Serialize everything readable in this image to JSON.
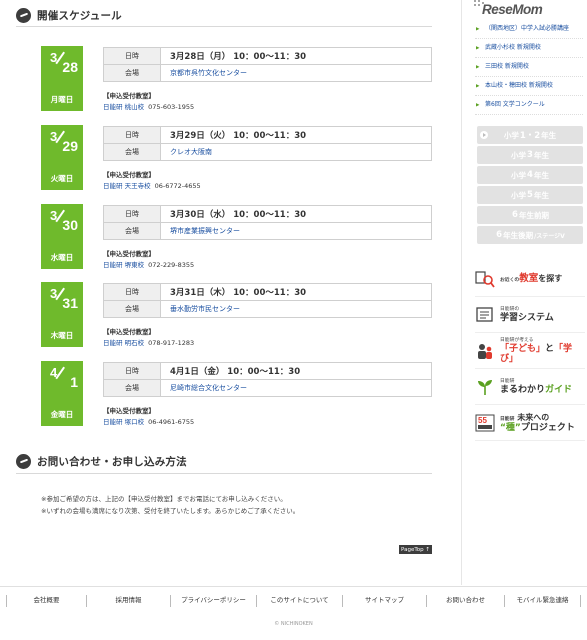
{
  "schedule": {
    "title": "開催スケジュール",
    "events": [
      {
        "month": "3",
        "day": "28",
        "weekday": "月曜日",
        "datetime_key": "日時",
        "datetime": "3月28日（月） 10：00～11：30",
        "venue_key": "会場",
        "venue": "京都市呉竹文化センター",
        "reg_label": "【申込受付教室】",
        "school": "日能研 桃山校",
        "phone": "075-603-1955"
      },
      {
        "month": "3",
        "day": "29",
        "weekday": "火曜日",
        "datetime_key": "日時",
        "datetime": "3月29日（火） 10：00～11：30",
        "venue_key": "会場",
        "venue": "クレオ大阪南",
        "reg_label": "【申込受付教室】",
        "school": "日能研 天王寺校",
        "phone": "06-6772-4655"
      },
      {
        "month": "3",
        "day": "30",
        "weekday": "水曜日",
        "datetime_key": "日時",
        "datetime": "3月30日（水） 10：00～11：30",
        "venue_key": "会場",
        "venue": "堺市産業振興センター",
        "reg_label": "【申込受付教室】",
        "school": "日能研 堺東校",
        "phone": "072-229-8355"
      },
      {
        "month": "3",
        "day": "31",
        "weekday": "木曜日",
        "datetime_key": "日時",
        "datetime": "3月31日（木） 10：00～11：30",
        "venue_key": "会場",
        "venue": "垂水勤労市民センター",
        "reg_label": "【申込受付教室】",
        "school": "日能研 明石校",
        "phone": "078-917-1283"
      },
      {
        "month": "4",
        "day": "1",
        "weekday": "金曜日",
        "datetime_key": "日時",
        "datetime": "4月1日（金） 10：00～11：30",
        "venue_key": "会場",
        "venue": "尼崎市総合文化センター",
        "reg_label": "【申込受付教室】",
        "school": "日能研 塚口校",
        "phone": "06-4961-6755"
      }
    ]
  },
  "contact": {
    "title": "お問い合わせ・お申し込み方法",
    "note1": "※参加ご希望の方は、上記の【申込受付教室】までお電話にてお申し込みください。",
    "note2": "※いずれの会場も満席になり次第、受付を終了いたします。あらかじめご了承ください。"
  },
  "pagetop": "PageTop ↑",
  "sidebar": {
    "logo": "ReseMom",
    "links": [
      "（関西地区）中学入試必勝講座",
      "武蔵小杉校 新規開校",
      "三田校 新規開校",
      "本山校・穂田校 新規開校",
      "第6回 文学コンクール"
    ],
    "grades": [
      {
        "pre": "小学",
        "num": "1・2",
        "post": "年生",
        "sub": ""
      },
      {
        "pre": "小学",
        "num": "3",
        "post": "年生",
        "sub": ""
      },
      {
        "pre": "小学",
        "num": "4",
        "post": "年生",
        "sub": ""
      },
      {
        "pre": "小学",
        "num": "5",
        "post": "年生",
        "sub": ""
      },
      {
        "pre": "",
        "num": "6",
        "post": "年生前期",
        "sub": ""
      },
      {
        "pre": "",
        "num": "6",
        "post": "年生後期",
        "sub": "/ステージV"
      }
    ],
    "banners": {
      "b1_small": "お近くの",
      "b1_big": "教室",
      "b1_tail": "を探す",
      "b2_small": "日能研の",
      "b2_big": "学習システム",
      "b3_small": "日能研が考える",
      "b3_big1": "「子ども」",
      "b3_mid": "と",
      "b3_big2": "「学び」",
      "b4_small": "日能研",
      "b4_big1": "まるわかり",
      "b4_big2": "ガイド",
      "b5_small": "日能研",
      "b5_big1": "未来への",
      "b5_big2": "“種”",
      "b5_big3": "プロジェクト"
    }
  },
  "footer": {
    "links": [
      "会社概要",
      "採用情報",
      "プライバシーポリシー",
      "このサイトについて",
      "サイトマップ",
      "お問い合わせ",
      "モバイル緊急連絡"
    ],
    "copyright": "© NICHINOKEN"
  },
  "colors": {
    "accent": "#6fba2c",
    "link": "#1a4fa0",
    "dark": "#3d3d3d"
  }
}
